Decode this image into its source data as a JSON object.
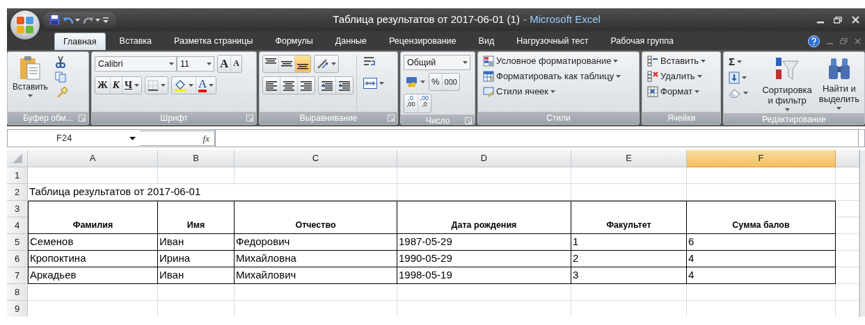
{
  "window": {
    "title": "Таблица результатов от 2017-06-01 (1)",
    "app": "- Microsoft Excel"
  },
  "tabs": [
    {
      "label": "Главная",
      "selected": true
    },
    {
      "label": "Вставка",
      "selected": false
    },
    {
      "label": "Разметка страницы",
      "selected": false
    },
    {
      "label": "Формулы",
      "selected": false
    },
    {
      "label": "Данные",
      "selected": false
    },
    {
      "label": "Рецензирование",
      "selected": false
    },
    {
      "label": "Вид",
      "selected": false
    },
    {
      "label": "Нагрузочный тест",
      "selected": false
    },
    {
      "label": "Рабочая группа",
      "selected": false
    }
  ],
  "ribbon": [
    {
      "kind": "clipboard",
      "label": "Буфер обм...",
      "launcher": true,
      "paste": "Вставить"
    },
    {
      "kind": "font",
      "label": "Шрифт",
      "launcher": true,
      "font": "Calibri",
      "size": "11",
      "grow": "A",
      "shrink": "A",
      "bold": "Ж",
      "italic": "К",
      "underline": "Ч",
      "font_color": "A"
    },
    {
      "kind": "alignment",
      "label": "Выравнивание",
      "launcher": true,
      "vertical": [
        {
          "kind": "top",
          "selected": false
        },
        {
          "kind": "middle",
          "selected": false
        },
        {
          "kind": "bottom",
          "selected": true
        }
      ],
      "horizontal": [
        {
          "kind": "left",
          "selected": false
        },
        {
          "kind": "center",
          "selected": false
        },
        {
          "kind": "right",
          "selected": false
        }
      ]
    },
    {
      "kind": "number",
      "label": "Число",
      "launcher": true,
      "format": "Общий",
      "percent": "%",
      "thousands": "000",
      "decimals": [
        {
          "top": ",0",
          "bottom": ",00"
        },
        {
          "top": ",00",
          "bottom": ",0"
        }
      ]
    },
    {
      "kind": "styles",
      "label": "Стили",
      "launcher": false,
      "items": [
        "Условное форматирование",
        "Форматировать как таблицу",
        "Стили ячеек"
      ]
    },
    {
      "kind": "cells",
      "label": "Ячейки",
      "launcher": false,
      "items": [
        "Вставить",
        "Удалить",
        "Формат"
      ]
    },
    {
      "kind": "editing",
      "label": "Редактирование",
      "launcher": false,
      "sum": "Σ",
      "sort": [
        "Сортировка",
        "и фильтр"
      ],
      "find": [
        "Найти и",
        "выделить"
      ]
    }
  ],
  "formula_bar": {
    "name_box": "F24",
    "fx": "fx"
  },
  "sheet": {
    "columns": [
      {
        "label": "A",
        "selected": false
      },
      {
        "label": "B",
        "selected": false
      },
      {
        "label": "C",
        "selected": false
      },
      {
        "label": "D",
        "selected": false
      },
      {
        "label": "E",
        "selected": false
      },
      {
        "label": "F",
        "selected": true
      }
    ],
    "row_numbers": [
      "1",
      "2",
      "3",
      "4",
      "5",
      "6",
      "7",
      "8",
      "9"
    ],
    "title_cell": "Таблица результатов от 2017-06-01",
    "headers": [
      "Фамилия",
      "Имя",
      "Отчество",
      "Дата рождения",
      "Факультет",
      "Сумма балов"
    ],
    "rows": [
      [
        "Семенов",
        "Иван",
        "Федорович",
        "1987-05-29",
        "1",
        "6"
      ],
      [
        "Кропоктина",
        "Ирина",
        "Михайловна",
        "1990-05-29",
        "2",
        "4"
      ],
      [
        "Аркадьев",
        "Иван",
        "Михайлович",
        "1998-05-19",
        "3",
        "4"
      ]
    ]
  }
}
